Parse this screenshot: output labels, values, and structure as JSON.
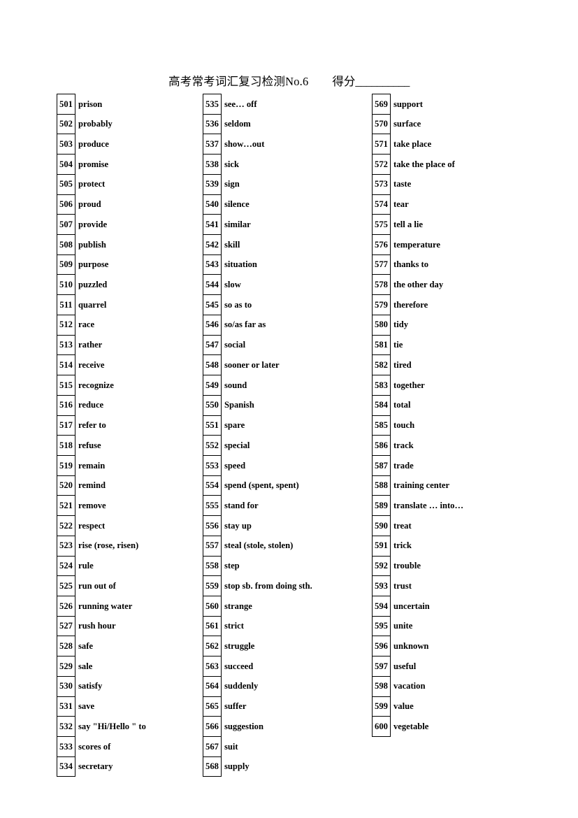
{
  "document": {
    "title": "高考常考词汇复习检测No.6",
    "score_label": "得分",
    "score_blank": "__________"
  },
  "columns": [
    {
      "name": "column-1",
      "entries": [
        {
          "num": "501",
          "word": "prison"
        },
        {
          "num": "502",
          "word": "probably"
        },
        {
          "num": "503",
          "word": "produce"
        },
        {
          "num": "504",
          "word": "promise"
        },
        {
          "num": "505",
          "word": "protect"
        },
        {
          "num": "506",
          "word": "proud"
        },
        {
          "num": "507",
          "word": "provide"
        },
        {
          "num": "508",
          "word": "publish"
        },
        {
          "num": "509",
          "word": "purpose"
        },
        {
          "num": "510",
          "word": "puzzled"
        },
        {
          "num": "511",
          "word": "quarrel"
        },
        {
          "num": "512",
          "word": "race"
        },
        {
          "num": "513",
          "word": "rather"
        },
        {
          "num": "514",
          "word": "receive"
        },
        {
          "num": "515",
          "word": "recognize"
        },
        {
          "num": "516",
          "word": "reduce"
        },
        {
          "num": "517",
          "word": "refer to"
        },
        {
          "num": "518",
          "word": "refuse"
        },
        {
          "num": "519",
          "word": "remain"
        },
        {
          "num": "520",
          "word": "remind"
        },
        {
          "num": "521",
          "word": "remove"
        },
        {
          "num": "522",
          "word": "respect"
        },
        {
          "num": "523",
          "word": "rise (rose, risen)"
        },
        {
          "num": "524",
          "word": "rule"
        },
        {
          "num": "525",
          "word": "run out of"
        },
        {
          "num": "526",
          "word": "running water"
        },
        {
          "num": "527",
          "word": "rush hour"
        },
        {
          "num": "528",
          "word": "safe"
        },
        {
          "num": "529",
          "word": "sale"
        },
        {
          "num": "530",
          "word": "satisfy"
        },
        {
          "num": "531",
          "word": "save"
        },
        {
          "num": "532",
          "word": "say \"Hi/Hello \" to"
        },
        {
          "num": "533",
          "word": "scores of"
        },
        {
          "num": "534",
          "word": "secretary"
        }
      ]
    },
    {
      "name": "column-2",
      "entries": [
        {
          "num": "535",
          "word": "see… off"
        },
        {
          "num": "536",
          "word": "seldom"
        },
        {
          "num": "537",
          "word": "show…out"
        },
        {
          "num": "538",
          "word": "sick"
        },
        {
          "num": "539",
          "word": "sign"
        },
        {
          "num": "540",
          "word": "silence"
        },
        {
          "num": "541",
          "word": "similar"
        },
        {
          "num": "542",
          "word": "skill"
        },
        {
          "num": "543",
          "word": "situation"
        },
        {
          "num": "544",
          "word": "slow"
        },
        {
          "num": "545",
          "word": "so as to"
        },
        {
          "num": "546",
          "word": "so/as far as"
        },
        {
          "num": "547",
          "word": "social"
        },
        {
          "num": "548",
          "word": "sooner or later"
        },
        {
          "num": "549",
          "word": "sound"
        },
        {
          "num": "550",
          "word": "Spanish"
        },
        {
          "num": "551",
          "word": "spare"
        },
        {
          "num": "552",
          "word": "special"
        },
        {
          "num": "553",
          "word": "speed"
        },
        {
          "num": "554",
          "word": "spend (spent, spent)"
        },
        {
          "num": "555",
          "word": "stand for"
        },
        {
          "num": "556",
          "word": "stay up"
        },
        {
          "num": "557",
          "word": "steal (stole, stolen)"
        },
        {
          "num": "558",
          "word": "step"
        },
        {
          "num": "559",
          "word": "stop sb. from doing sth."
        },
        {
          "num": "560",
          "word": "strange"
        },
        {
          "num": "561",
          "word": "strict"
        },
        {
          "num": "562",
          "word": "struggle"
        },
        {
          "num": "563",
          "word": "succeed"
        },
        {
          "num": "564",
          "word": "suddenly"
        },
        {
          "num": "565",
          "word": "suffer"
        },
        {
          "num": "566",
          "word": "suggestion"
        },
        {
          "num": "567",
          "word": "suit"
        },
        {
          "num": "568",
          "word": "supply"
        }
      ]
    },
    {
      "name": "column-3",
      "entries": [
        {
          "num": "569",
          "word": "support"
        },
        {
          "num": "570",
          "word": "surface"
        },
        {
          "num": "571",
          "word": "take place"
        },
        {
          "num": "572",
          "word": "take the place of"
        },
        {
          "num": "573",
          "word": "taste"
        },
        {
          "num": "574",
          "word": "tear"
        },
        {
          "num": "575",
          "word": "tell a lie"
        },
        {
          "num": "576",
          "word": "temperature"
        },
        {
          "num": "577",
          "word": "thanks to"
        },
        {
          "num": "578",
          "word": "the other day"
        },
        {
          "num": "579",
          "word": "therefore"
        },
        {
          "num": "580",
          "word": "tidy"
        },
        {
          "num": "581",
          "word": "tie"
        },
        {
          "num": "582",
          "word": "tired"
        },
        {
          "num": "583",
          "word": "together"
        },
        {
          "num": "584",
          "word": "total"
        },
        {
          "num": "585",
          "word": "touch"
        },
        {
          "num": "586",
          "word": "track"
        },
        {
          "num": "587",
          "word": "trade"
        },
        {
          "num": "588",
          "word": "training center"
        },
        {
          "num": "589",
          "word": "translate … into…"
        },
        {
          "num": "590",
          "word": "treat"
        },
        {
          "num": "591",
          "word": "trick"
        },
        {
          "num": "592",
          "word": "trouble"
        },
        {
          "num": "593",
          "word": "trust"
        },
        {
          "num": "594",
          "word": "uncertain"
        },
        {
          "num": "595",
          "word": "unite"
        },
        {
          "num": "596",
          "word": "unknown"
        },
        {
          "num": "597",
          "word": "useful"
        },
        {
          "num": "598",
          "word": "vacation"
        },
        {
          "num": "599",
          "word": "value"
        },
        {
          "num": "600",
          "word": "vegetable"
        }
      ]
    }
  ]
}
